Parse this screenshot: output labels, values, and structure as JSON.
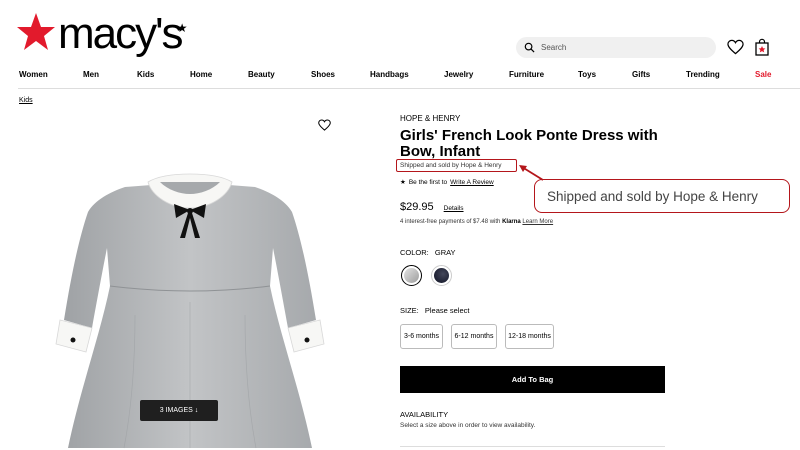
{
  "header": {
    "logo_text": "macy's",
    "search_placeholder": "Search"
  },
  "nav": {
    "items": [
      "Women",
      "Men",
      "Kids",
      "Home",
      "Beauty",
      "Shoes",
      "Handbags",
      "Jewelry",
      "Furniture",
      "Toys",
      "Gifts",
      "Trending",
      "Sale"
    ]
  },
  "breadcrumb": "Kids",
  "image": {
    "images_button": "3 IMAGES ↓"
  },
  "product": {
    "brand": "HOPE & HENRY",
    "title": "Girls' French Look Ponte Dress with Bow, Infant",
    "shipped_by": "Shipped and sold by Hope & Henry",
    "review_prefix": "Be the first to",
    "review_link": "Write A Review",
    "price": "$29.95",
    "details_link": "Details",
    "klarna_text": "4 interest-free payments of $7.48 with",
    "klarna_brand": "Klarna",
    "learn_more": "Learn More",
    "color_label": "COLOR:",
    "color_value": "GRAY",
    "size_label": "SIZE:",
    "size_value": "Please select",
    "sizes": [
      "3-6 months",
      "6-12 months",
      "12-18 months"
    ],
    "add_to_bag": "Add To Bag",
    "availability_title": "AVAILABILITY",
    "availability_text": "Select a size above in order to view availability."
  },
  "annotation": {
    "callout_text": "Shipped and sold by Hope & Henry",
    "color": "#b4161b"
  },
  "colors": {
    "brand_red": "#e21a2c",
    "dress_gray": "#a9acaf",
    "dress_gray_light": "#c2c4c6"
  }
}
